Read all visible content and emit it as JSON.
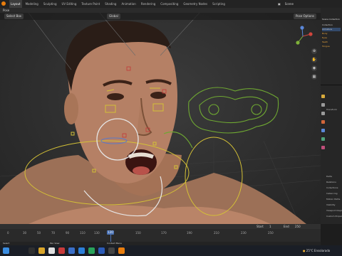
{
  "workspaces": [
    "Layout",
    "Modeling",
    "Sculpting",
    "UV Editing",
    "Texture Paint",
    "Shading",
    "Animation",
    "Rendering",
    "Compositing",
    "Geometry Nodes",
    "Scripting"
  ],
  "active_workspace": "Layout",
  "scene_name": "Scene",
  "mode": "Pose",
  "header": {
    "select_box": "Select Box",
    "global": "Global",
    "pose_options": "Pose Options"
  },
  "outliner": {
    "title": "Scene Collection",
    "rows": [
      "Collection",
      "Armature",
      "Body",
      "Eyes",
      "Teeth",
      "Tongue"
    ]
  },
  "properties": {
    "rows": [
      "Transform",
      "Delta",
      "Relations",
      "Collections",
      "Instancing",
      "Motion Paths",
      "Visibility",
      "Viewport Display",
      "Custom Properties"
    ]
  },
  "timeline": {
    "ticks": [
      "0",
      "30",
      "50",
      "70",
      "90",
      "110",
      "130",
      "150",
      "170",
      "190",
      "210",
      "230",
      "250"
    ],
    "current_frame": "120",
    "start_label": "Start",
    "start": "1",
    "end_label": "End",
    "end": "250"
  },
  "status": {
    "left": "Select",
    "right": "Pan View",
    "context": "Context Menu"
  },
  "taskbar": {
    "weather": "25°C Ensolarado",
    "time": ""
  },
  "colors": {
    "accent": "#e87d0d",
    "bone_green": "#6fa832",
    "bone_yellow": "#d4c136",
    "bone_white": "#e6e6e6"
  }
}
